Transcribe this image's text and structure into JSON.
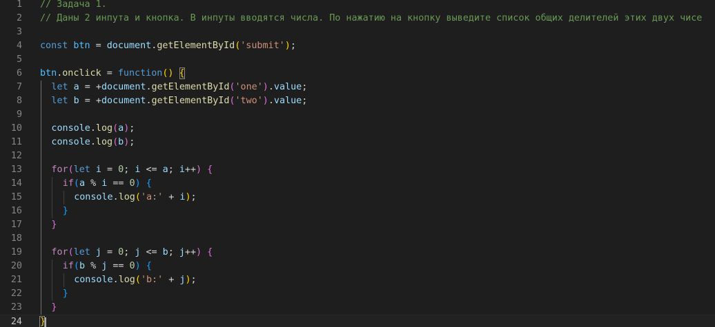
{
  "editor": {
    "language": "javascript",
    "theme": "dark",
    "active_line": 24,
    "lines": [
      {
        "n": "1",
        "indent": 0,
        "tokens": [
          [
            "comment",
            "// Задача 1."
          ]
        ]
      },
      {
        "n": "2",
        "indent": 0,
        "tokens": [
          [
            "comment",
            "// Даны 2 инпута и кнопка. В инпуты вводятся числа. По нажатию на кнопку выведите список общих делителей этих двух чисе"
          ]
        ]
      },
      {
        "n": "3",
        "indent": 0,
        "tokens": []
      },
      {
        "n": "4",
        "indent": 0,
        "tokens": [
          [
            "kw",
            "const"
          ],
          [
            "op",
            " "
          ],
          [
            "const",
            "btn"
          ],
          [
            "op",
            " = "
          ],
          [
            "var",
            "document"
          ],
          [
            "op",
            "."
          ],
          [
            "fn",
            "getElementById"
          ],
          [
            "b1",
            "("
          ],
          [
            "str",
            "'submit'"
          ],
          [
            "b1",
            ")"
          ],
          [
            "op",
            ";"
          ]
        ]
      },
      {
        "n": "5",
        "indent": 0,
        "tokens": []
      },
      {
        "n": "6",
        "indent": 0,
        "tokens": [
          [
            "const",
            "btn"
          ],
          [
            "op",
            "."
          ],
          [
            "fn",
            "onclick"
          ],
          [
            "op",
            " = "
          ],
          [
            "kw",
            "function"
          ],
          [
            "b1",
            "()"
          ],
          [
            "op",
            " "
          ],
          [
            "b1",
            "{"
          ]
        ]
      },
      {
        "n": "7",
        "indent": 1,
        "tokens": [
          [
            "kw",
            "let"
          ],
          [
            "op",
            " "
          ],
          [
            "var",
            "a"
          ],
          [
            "op",
            " = +"
          ],
          [
            "var",
            "document"
          ],
          [
            "op",
            "."
          ],
          [
            "fn",
            "getElementById"
          ],
          [
            "b2",
            "("
          ],
          [
            "str",
            "'one'"
          ],
          [
            "b2",
            ")"
          ],
          [
            "op",
            "."
          ],
          [
            "var",
            "value"
          ],
          [
            "op",
            ";"
          ]
        ]
      },
      {
        "n": "8",
        "indent": 1,
        "tokens": [
          [
            "kw",
            "let"
          ],
          [
            "op",
            " "
          ],
          [
            "var",
            "b"
          ],
          [
            "op",
            " = +"
          ],
          [
            "var",
            "document"
          ],
          [
            "op",
            "."
          ],
          [
            "fn",
            "getElementById"
          ],
          [
            "b2",
            "("
          ],
          [
            "str",
            "'two'"
          ],
          [
            "b2",
            ")"
          ],
          [
            "op",
            "."
          ],
          [
            "var",
            "value"
          ],
          [
            "op",
            ";"
          ]
        ]
      },
      {
        "n": "9",
        "indent": 1,
        "tokens": []
      },
      {
        "n": "10",
        "indent": 1,
        "tokens": [
          [
            "var",
            "console"
          ],
          [
            "op",
            "."
          ],
          [
            "fn",
            "log"
          ],
          [
            "b2",
            "("
          ],
          [
            "var",
            "a"
          ],
          [
            "b2",
            ")"
          ],
          [
            "op",
            ";"
          ]
        ]
      },
      {
        "n": "11",
        "indent": 1,
        "tokens": [
          [
            "var",
            "console"
          ],
          [
            "op",
            "."
          ],
          [
            "fn",
            "log"
          ],
          [
            "b2",
            "("
          ],
          [
            "var",
            "b"
          ],
          [
            "b2",
            ")"
          ],
          [
            "op",
            ";"
          ]
        ]
      },
      {
        "n": "12",
        "indent": 1,
        "tokens": []
      },
      {
        "n": "13",
        "indent": 1,
        "tokens": [
          [
            "ctrl",
            "for"
          ],
          [
            "b2",
            "("
          ],
          [
            "kw",
            "let"
          ],
          [
            "op",
            " "
          ],
          [
            "var",
            "i"
          ],
          [
            "op",
            " = "
          ],
          [
            "num",
            "0"
          ],
          [
            "op",
            "; "
          ],
          [
            "var",
            "i"
          ],
          [
            "op",
            " <= "
          ],
          [
            "var",
            "a"
          ],
          [
            "op",
            "; "
          ],
          [
            "var",
            "i"
          ],
          [
            "op",
            "++"
          ],
          [
            "b2",
            ")"
          ],
          [
            "op",
            " "
          ],
          [
            "b2",
            "{"
          ]
        ]
      },
      {
        "n": "14",
        "indent": 2,
        "tokens": [
          [
            "ctrl",
            "if"
          ],
          [
            "b3",
            "("
          ],
          [
            "var",
            "a"
          ],
          [
            "op",
            " % "
          ],
          [
            "var",
            "i"
          ],
          [
            "op",
            " == "
          ],
          [
            "num",
            "0"
          ],
          [
            "b3",
            ")"
          ],
          [
            "op",
            " "
          ],
          [
            "b3",
            "{"
          ]
        ]
      },
      {
        "n": "15",
        "indent": 3,
        "tokens": [
          [
            "var",
            "console"
          ],
          [
            "op",
            "."
          ],
          [
            "fn",
            "log"
          ],
          [
            "b1",
            "("
          ],
          [
            "str",
            "'a:'"
          ],
          [
            "op",
            " + "
          ],
          [
            "var",
            "i"
          ],
          [
            "b1",
            ")"
          ],
          [
            "op",
            ";"
          ]
        ]
      },
      {
        "n": "16",
        "indent": 2,
        "tokens": [
          [
            "b3",
            "}"
          ]
        ]
      },
      {
        "n": "17",
        "indent": 1,
        "tokens": [
          [
            "b2",
            "}"
          ]
        ]
      },
      {
        "n": "18",
        "indent": 1,
        "tokens": []
      },
      {
        "n": "19",
        "indent": 1,
        "tokens": [
          [
            "ctrl",
            "for"
          ],
          [
            "b2",
            "("
          ],
          [
            "kw",
            "let"
          ],
          [
            "op",
            " "
          ],
          [
            "var",
            "j"
          ],
          [
            "op",
            " = "
          ],
          [
            "num",
            "0"
          ],
          [
            "op",
            "; "
          ],
          [
            "var",
            "j"
          ],
          [
            "op",
            " <= "
          ],
          [
            "var",
            "b"
          ],
          [
            "op",
            "; "
          ],
          [
            "var",
            "j"
          ],
          [
            "op",
            "++"
          ],
          [
            "b2",
            ")"
          ],
          [
            "op",
            " "
          ],
          [
            "b2",
            "{"
          ]
        ]
      },
      {
        "n": "20",
        "indent": 2,
        "tokens": [
          [
            "ctrl",
            "if"
          ],
          [
            "b3",
            "("
          ],
          [
            "var",
            "b"
          ],
          [
            "op",
            " % "
          ],
          [
            "var",
            "j"
          ],
          [
            "op",
            " == "
          ],
          [
            "num",
            "0"
          ],
          [
            "b3",
            ")"
          ],
          [
            "op",
            " "
          ],
          [
            "b3",
            "{"
          ]
        ]
      },
      {
        "n": "21",
        "indent": 3,
        "tokens": [
          [
            "var",
            "console"
          ],
          [
            "op",
            "."
          ],
          [
            "fn",
            "log"
          ],
          [
            "b1",
            "("
          ],
          [
            "str",
            "'b:'"
          ],
          [
            "op",
            " + "
          ],
          [
            "var",
            "j"
          ],
          [
            "b1",
            ")"
          ],
          [
            "op",
            ";"
          ]
        ]
      },
      {
        "n": "22",
        "indent": 2,
        "tokens": [
          [
            "b3",
            "}"
          ]
        ]
      },
      {
        "n": "23",
        "indent": 1,
        "tokens": [
          [
            "b2",
            "}"
          ]
        ]
      },
      {
        "n": "24",
        "indent": 0,
        "tokens": [
          [
            "b1",
            "}"
          ]
        ]
      }
    ]
  }
}
